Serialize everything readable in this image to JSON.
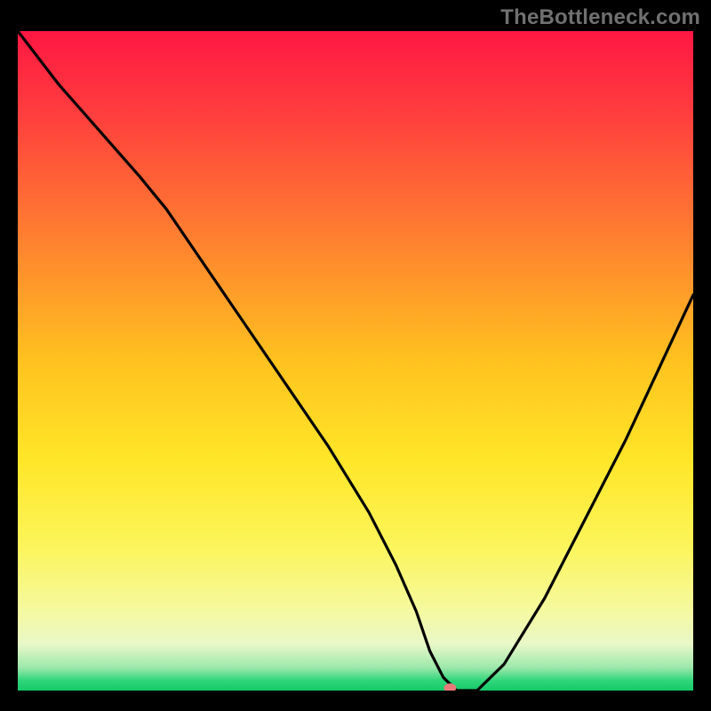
{
  "watermark": "TheBottleneck.com",
  "chart_data": {
    "type": "line",
    "title": "",
    "xlabel": "",
    "ylabel": "",
    "xlim": [
      0,
      100
    ],
    "ylim": [
      0,
      100
    ],
    "grid": false,
    "legend": false,
    "background": {
      "gradient_stops": [
        {
          "offset": 0.0,
          "color": "#ff1743"
        },
        {
          "offset": 0.12,
          "color": "#ff3c3e"
        },
        {
          "offset": 0.3,
          "color": "#ff7b31"
        },
        {
          "offset": 0.5,
          "color": "#ffc21f"
        },
        {
          "offset": 0.65,
          "color": "#ffe628"
        },
        {
          "offset": 0.78,
          "color": "#fcf55a"
        },
        {
          "offset": 0.88,
          "color": "#f5f9a0"
        },
        {
          "offset": 0.93,
          "color": "#e8f8c8"
        },
        {
          "offset": 0.965,
          "color": "#9de8ab"
        },
        {
          "offset": 0.985,
          "color": "#2fd67a"
        },
        {
          "offset": 1.0,
          "color": "#15c969"
        }
      ]
    },
    "series": [
      {
        "name": "bottleneck-curve",
        "x": [
          0,
          6,
          12,
          18,
          22,
          28,
          34,
          40,
          46,
          52,
          56,
          59,
          61,
          63,
          65,
          68,
          72,
          78,
          84,
          90,
          95,
          100
        ],
        "values": [
          100,
          92,
          85,
          78,
          73,
          64,
          55,
          46,
          37,
          27,
          19,
          12,
          6,
          2,
          0,
          0,
          4,
          14,
          26,
          38,
          49,
          60
        ]
      }
    ],
    "marker": {
      "x": 64,
      "y": 0,
      "rx": 7,
      "ry": 5,
      "color": "#e97a7a",
      "name": "optimal-point"
    }
  }
}
